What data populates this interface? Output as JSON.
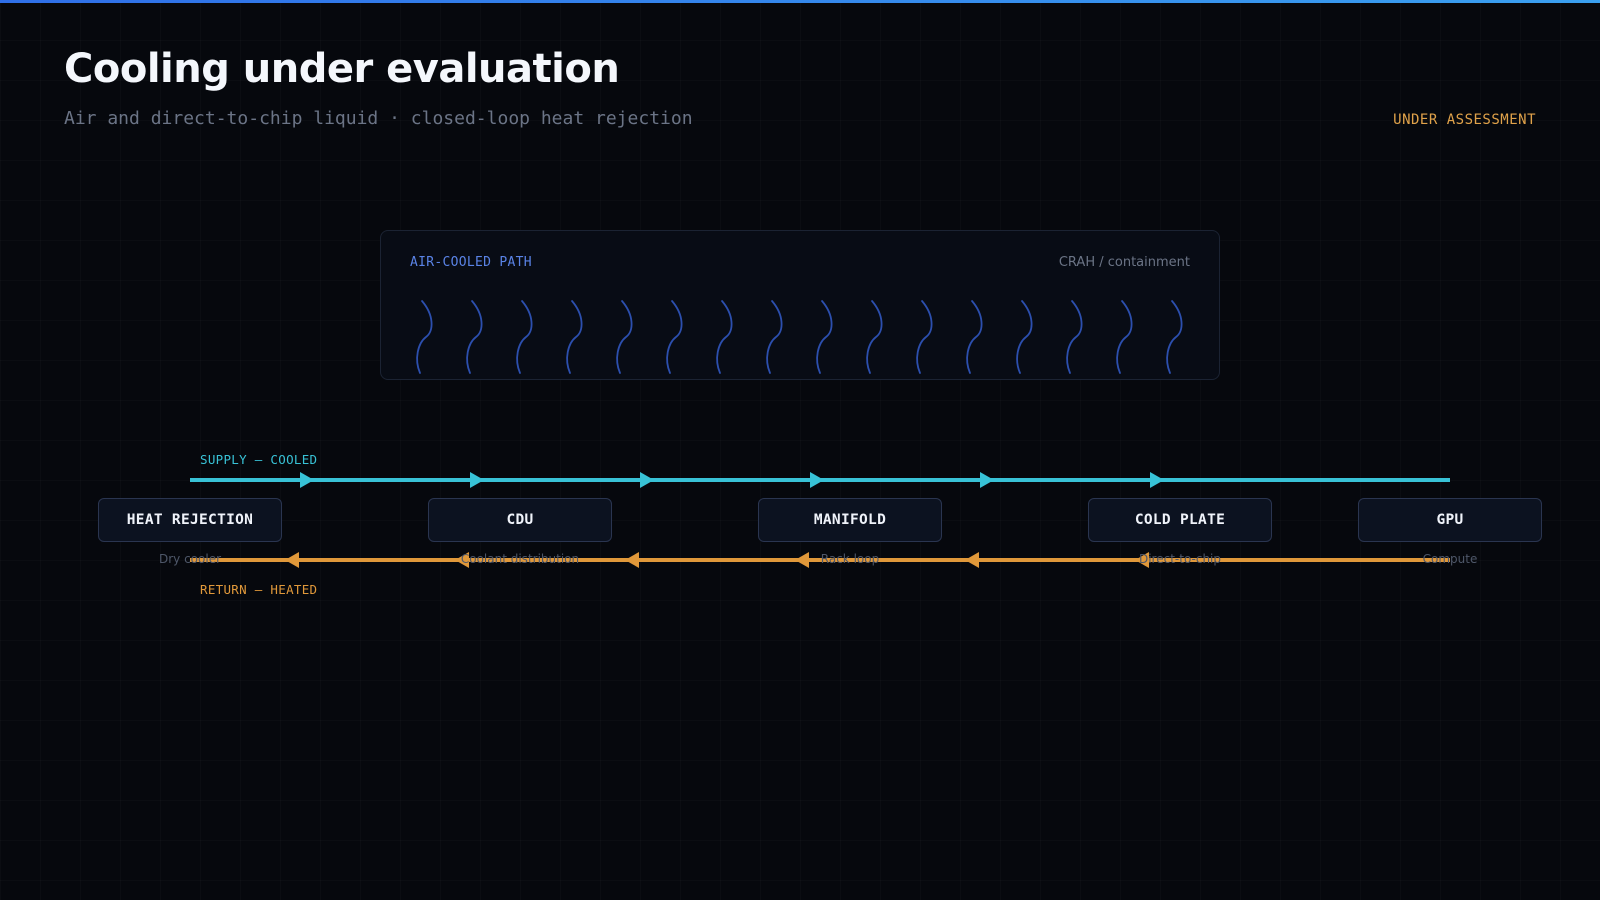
{
  "header": {
    "title": "Cooling under evaluation",
    "subtitle": "Air and direct-to-chip liquid · closed-loop heat rejection",
    "status": "UNDER ASSESSMENT"
  },
  "air_panel": {
    "label": "AIR-COOLED PATH",
    "sublabel": "CRAH / containment",
    "airflow_wave_count": 16
  },
  "flow": {
    "supply_label": "SUPPLY — COOLED",
    "return_label": "RETURN — HEATED",
    "supply_arrow_count": 6,
    "return_arrow_count": 6,
    "nodes": [
      {
        "name": "HEAT REJECTION",
        "sublabel": "Dry cooler"
      },
      {
        "name": "CDU",
        "sublabel": "Coolant distribution"
      },
      {
        "name": "MANIFOLD",
        "sublabel": "Rack loop"
      },
      {
        "name": "COLD PLATE",
        "sublabel": "Direct-to-chip"
      },
      {
        "name": "GPU",
        "sublabel": "Compute"
      }
    ]
  },
  "colors": {
    "accent": "#2f6fe8",
    "supply": "#38c2d6",
    "return": "#e0983a",
    "status": "#e0a24a",
    "airflow": "#2c4fae"
  }
}
